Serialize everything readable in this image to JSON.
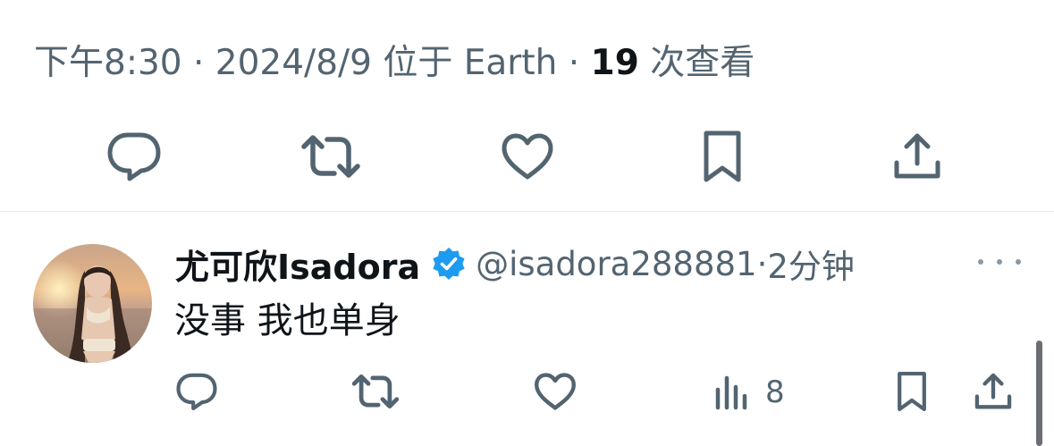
{
  "tweet_meta": {
    "time": "下午8:30",
    "dot1": " · ",
    "date": "2024/8/9",
    "location": " 位于 Earth",
    "dot2": " · ",
    "views_count": "19",
    "views_label": " 次查看"
  },
  "main_actions": {
    "icons": [
      "reply-icon",
      "retweet-icon",
      "like-icon",
      "bookmark-icon",
      "share-icon"
    ]
  },
  "reply": {
    "display_name": "尤可欣Isadora",
    "verified": true,
    "handle": "@isadora288881",
    "separator": "·",
    "time": "2分钟",
    "text": "没事 我也单身",
    "views_count": "8",
    "icons": [
      "reply-icon",
      "retweet-icon",
      "like-icon",
      "views-icon",
      "bookmark-icon",
      "share-icon"
    ]
  },
  "colors": {
    "text_primary": "#0f1419",
    "text_secondary": "#536471",
    "verified_blue": "#1d9bf0",
    "divider": "#e6e9eb"
  }
}
